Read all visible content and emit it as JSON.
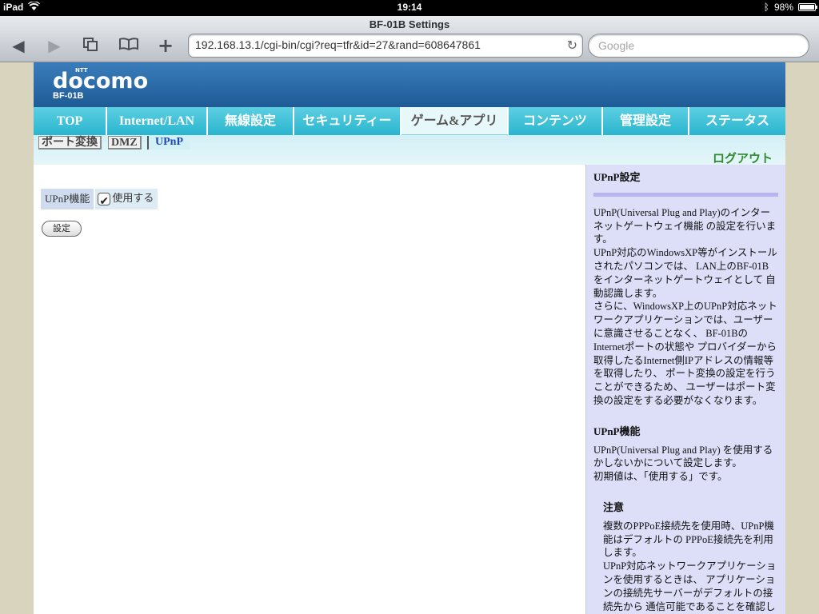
{
  "status_bar": {
    "device": "iPad",
    "time": "19:14",
    "battery": "98%",
    "battery_level": 0.98
  },
  "browser": {
    "title": "BF-01B Settings",
    "url": "192.168.13.1/cgi-bin/cgi?req=tfr&id=27&rand=608647861",
    "search_placeholder": "Google"
  },
  "header": {
    "brand_small": "NTT",
    "brand": "docomo",
    "model": "BF-01B"
  },
  "nav": {
    "tabs": [
      {
        "label": "TOP"
      },
      {
        "label": "Internet/LAN"
      },
      {
        "label": "無線設定"
      },
      {
        "label": "セキュリティー"
      },
      {
        "label": "ゲーム&アプリ"
      },
      {
        "label": "コンテンツ"
      },
      {
        "label": "管理設定"
      },
      {
        "label": "ステータス"
      }
    ],
    "active_index": 4
  },
  "subnav": {
    "tabs": [
      {
        "label": "ポート変換"
      },
      {
        "label": "DMZ"
      },
      {
        "label": "UPnP"
      }
    ],
    "logout": "ログアウト"
  },
  "form": {
    "upnp_label": "UPnP機能",
    "enable_label": "使用する",
    "enable_checked": true,
    "submit_label": "設定"
  },
  "help": {
    "title": "UPnP設定",
    "intro": "UPnP(Universal Plug and Play)のインターネットゲートウェイ機能 の設定を行います。",
    "p2": "UPnP対応のWindowsXP等がインストールされたパソコンでは、 LAN上のBF-01Bをインターネットゲートウェイとして 自動認識します。",
    "p3": "さらに、WindowsXP上のUPnP対応ネットワークアプリケーションでは、ユーザーに意識させることなく、 BF-01BのInternetポートの状態や プロバイダーから取得したるInternet側IPアドレスの情報等を取得したり、 ポート変換の設定を行うことができるため、 ユーザーはポート変換の設定をする必要がなくなります。",
    "section2_title": "UPnP機能",
    "section2_text": "UPnP(Universal Plug and Play) を使用するかしないかについて設定します。",
    "section2_default": "初期値は、「使用する」です。",
    "note_title": "注意",
    "note_p1": "複数のPPPoE接続先を使用時、UPnP機能はデフォルトの PPPoE接続先を利用します。",
    "note_p2": "UPnP対応ネットワークアプリケーションを使用するときは、 アプリケーションの接続先サーバーがデフォルトの接続先から 通信可能であることを確認し"
  }
}
